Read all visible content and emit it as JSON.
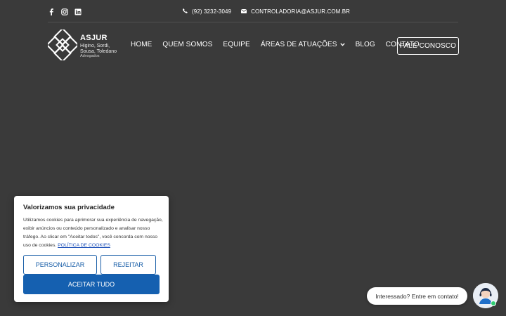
{
  "topbar": {
    "social": [
      "facebook-icon",
      "instagram-icon",
      "linkedin-icon"
    ],
    "phone": "(92) 3232-3049",
    "email": "CONTROLADORIA@ASJUR.COM.BR"
  },
  "logo": {
    "brand": "ASJUR",
    "line1": "Higino, Sordi,",
    "line2": "Sousa, Toledano",
    "line3": "Advogados"
  },
  "nav": {
    "items": [
      "HOME",
      "QUEM SOMOS",
      "EQUIPE",
      "ÁREAS DE ATUAÇÕES",
      "BLOG",
      "CONTATO"
    ],
    "cta": "FALE CONOSCO"
  },
  "cookie": {
    "title": "Valorizamos sua privacidade",
    "body": "Utilizamos cookies para aprimorar sua experiência de navegação, exibir anúncios ou conteúdo personalizado e analisar nosso tráfego. Ao clicar em \"Aceitar todos\", você concorda com nosso uso de cookies.",
    "policy_link": "POLÍTICA DE COOKIES",
    "customize": "PERSONALIZAR",
    "reject": "REJEITAR",
    "accept_all": "ACEITAR TUDO"
  },
  "chat": {
    "bubble": "Interessado? Entre em contato!"
  },
  "colors": {
    "background": "#3a3a3a",
    "primary_blue": "#1560b0",
    "online": "#2ecc71"
  }
}
